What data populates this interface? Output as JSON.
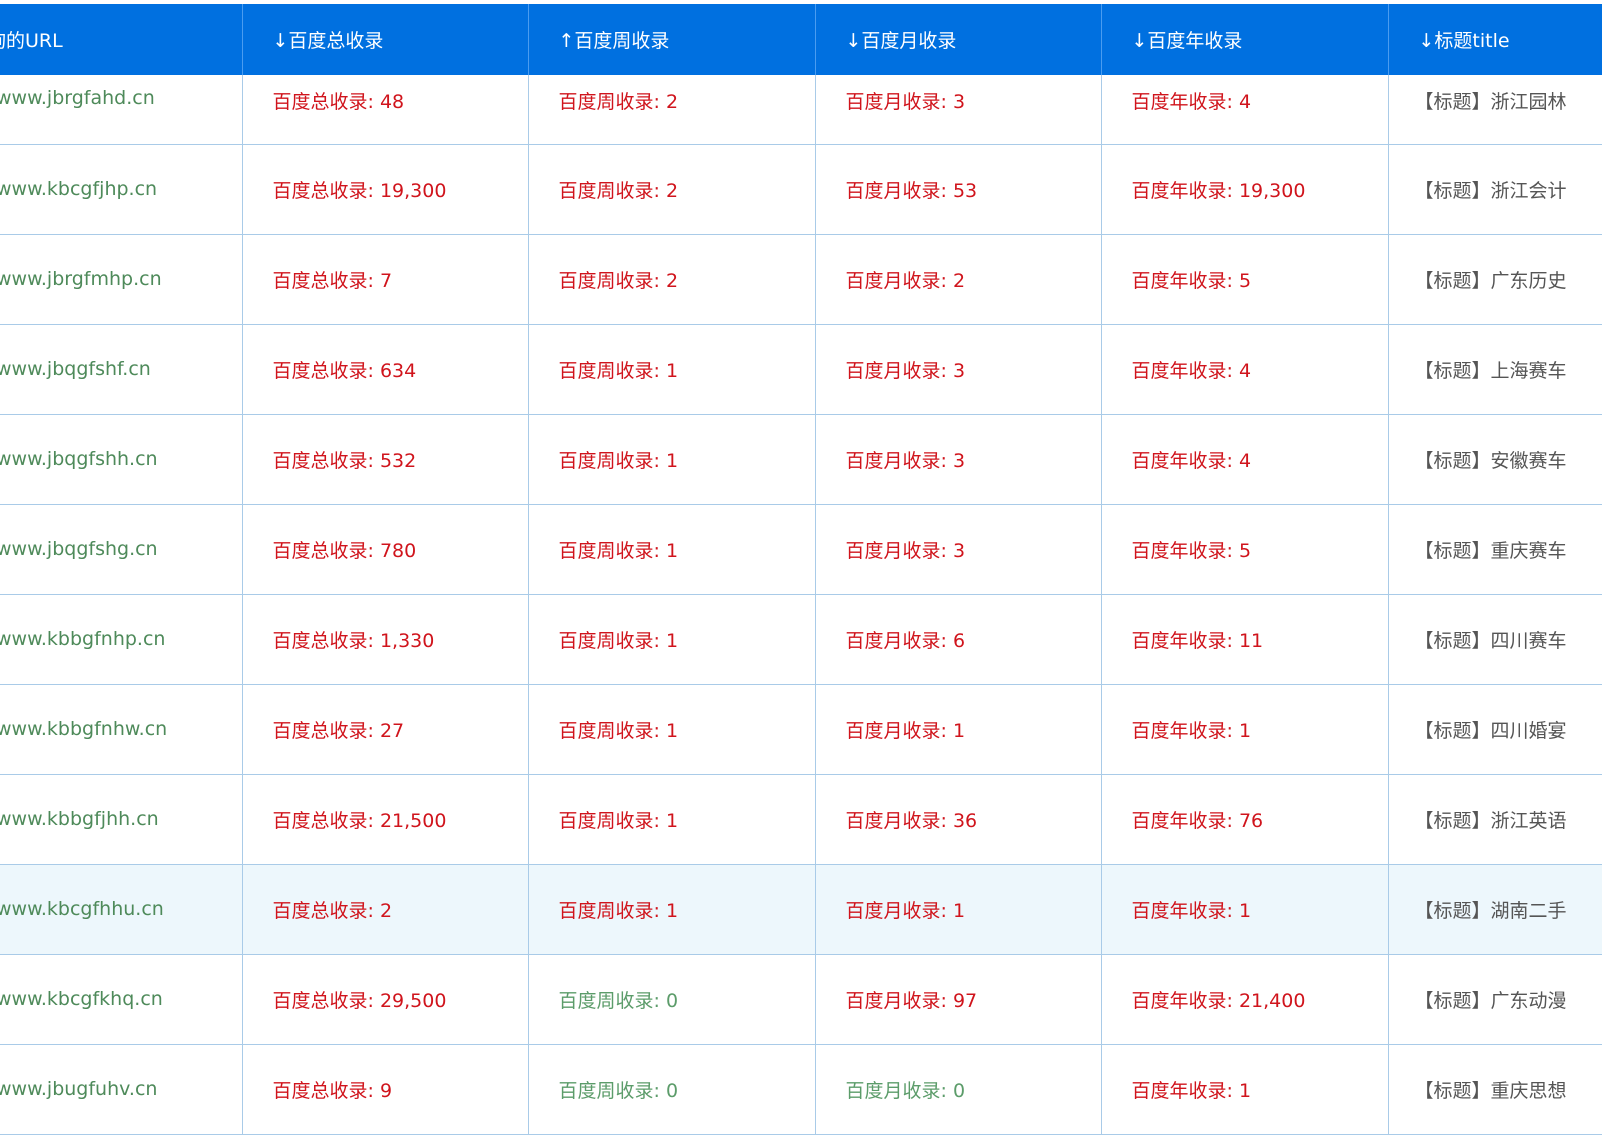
{
  "colors": {
    "header_bg": "#0070e0",
    "value_red": "#d0141c",
    "value_zero_green": "#5c9c6a",
    "url_green": "#4e8a5a",
    "highlight_row": "#edf7fc"
  },
  "headers": [
    "查询的URL",
    "↓百度总收录",
    "↑百度周收录",
    "↓百度月收录",
    "↓百度年收录",
    "↓标题title"
  ],
  "rows": [
    {
      "url": "www.jbrgfahd.cn",
      "total": "百度总收录: 48",
      "week": "百度周收录: 2",
      "month": "百度月收录: 3",
      "year": "百度年收录: 4",
      "title": "【标题】浙江园林"
    },
    {
      "url": "www.kbcgfjhp.cn",
      "total": "百度总收录: 19,300",
      "week": "百度周收录: 2",
      "month": "百度月收录: 53",
      "year": "百度年收录: 19,300",
      "title": "【标题】浙江会计"
    },
    {
      "url": "www.jbrgfmhp.cn",
      "total": "百度总收录: 7",
      "week": "百度周收录: 2",
      "month": "百度月收录: 2",
      "year": "百度年收录: 5",
      "title": "【标题】广东历史"
    },
    {
      "url": "www.jbqgfshf.cn",
      "total": "百度总收录: 634",
      "week": "百度周收录: 1",
      "month": "百度月收录: 3",
      "year": "百度年收录: 4",
      "title": "【标题】上海赛车"
    },
    {
      "url": "www.jbqgfshh.cn",
      "total": "百度总收录: 532",
      "week": "百度周收录: 1",
      "month": "百度月收录: 3",
      "year": "百度年收录: 4",
      "title": "【标题】安徽赛车"
    },
    {
      "url": "www.jbqgfshg.cn",
      "total": "百度总收录: 780",
      "week": "百度周收录: 1",
      "month": "百度月收录: 3",
      "year": "百度年收录: 5",
      "title": "【标题】重庆赛车"
    },
    {
      "url": "www.kbbgfnhp.cn",
      "total": "百度总收录: 1,330",
      "week": "百度周收录: 1",
      "month": "百度月收录: 6",
      "year": "百度年收录: 11",
      "title": "【标题】四川赛车"
    },
    {
      "url": "www.kbbgfnhw.cn",
      "total": "百度总收录: 27",
      "week": "百度周收录: 1",
      "month": "百度月收录: 1",
      "year": "百度年收录: 1",
      "title": "【标题】四川婚宴"
    },
    {
      "url": "www.kbbgfjhh.cn",
      "total": "百度总收录: 21,500",
      "week": "百度周收录: 1",
      "month": "百度月收录: 36",
      "year": "百度年收录: 76",
      "title": "【标题】浙江英语"
    },
    {
      "url": "www.kbcgfhhu.cn",
      "total": "百度总收录: 2",
      "week": "百度周收录: 1",
      "month": "百度月收录: 1",
      "year": "百度年收录: 1",
      "title": "【标题】湖南二手"
    },
    {
      "url": "www.kbcgfkhq.cn",
      "total": "百度总收录: 29,500",
      "week": "百度周收录: 0",
      "month": "百度月收录: 97",
      "year": "百度年收录: 21,400",
      "title": "【标题】广东动漫"
    },
    {
      "url": "www.jbugfuhv.cn",
      "total": "百度总收录: 9",
      "week": "百度周收录: 0",
      "month": "百度月收录: 0",
      "year": "百度年收录: 1",
      "title": "【标题】重庆思想"
    }
  ]
}
